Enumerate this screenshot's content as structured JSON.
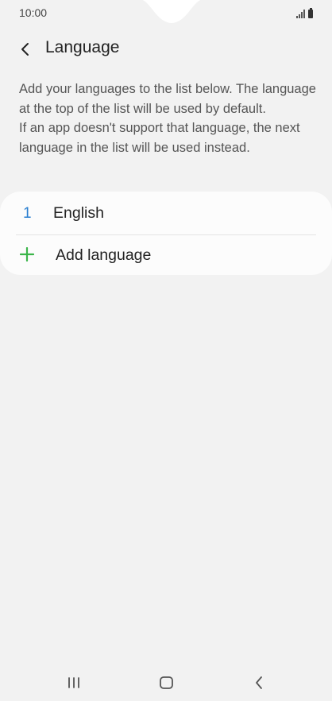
{
  "status_bar": {
    "time": "10:00"
  },
  "header": {
    "title": "Language",
    "back_icon": "chevron-left-icon"
  },
  "description": {
    "line1": "Add your languages to the list below. The language at the top of the list will be used by default.",
    "line2": "If an app doesn't support that language, the next language in the list will be used instead."
  },
  "languages": [
    {
      "index": "1",
      "name": "English"
    }
  ],
  "add_language": {
    "label": "Add language",
    "icon": "plus-icon"
  },
  "colors": {
    "background": "#f2f2f2",
    "card": "#fcfcfc",
    "index_blue": "#2a7fd0",
    "plus_green": "#3bb54a"
  },
  "nav_bar": {
    "recents_icon": "recents-icon",
    "home_icon": "home-icon",
    "back_icon": "back-icon"
  }
}
